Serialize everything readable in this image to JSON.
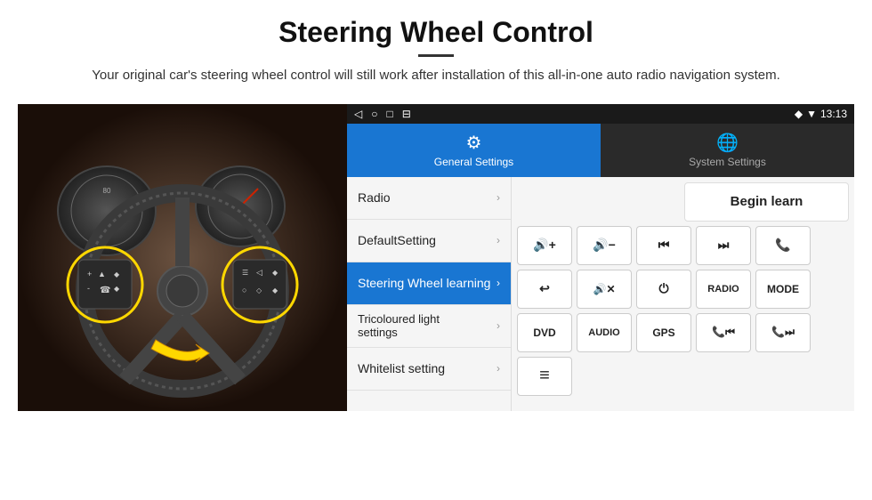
{
  "header": {
    "title": "Steering Wheel Control",
    "subtitle": "Your original car's steering wheel control will still work after installation of this all-in-one auto radio navigation system."
  },
  "android": {
    "status_bar": {
      "left_icons": [
        "◁",
        "○",
        "□",
        "⊟"
      ],
      "right_text": "13:13"
    },
    "tabs": [
      {
        "id": "general",
        "label": "General Settings",
        "active": true
      },
      {
        "id": "system",
        "label": "System Settings",
        "active": false
      }
    ],
    "menu": [
      {
        "id": "radio",
        "label": "Radio",
        "active": false
      },
      {
        "id": "default",
        "label": "DefaultSetting",
        "active": false
      },
      {
        "id": "steering",
        "label": "Steering Wheel learning",
        "active": true
      },
      {
        "id": "tricoloured",
        "label": "Tricoloured light settings",
        "active": false
      },
      {
        "id": "whitelist",
        "label": "Whitelist setting",
        "active": false
      }
    ],
    "controls": {
      "begin_learn": "Begin learn",
      "rows": [
        [
          "🔊+",
          "🔊−",
          "⏮",
          "⏭",
          "📞"
        ],
        [
          "↩",
          "🔊✕",
          "⏻",
          "RADIO",
          "MODE"
        ],
        [
          "DVD",
          "AUDIO",
          "GPS",
          "📞⏮",
          "📞⏭"
        ]
      ],
      "bottom_icon": "≡"
    }
  }
}
